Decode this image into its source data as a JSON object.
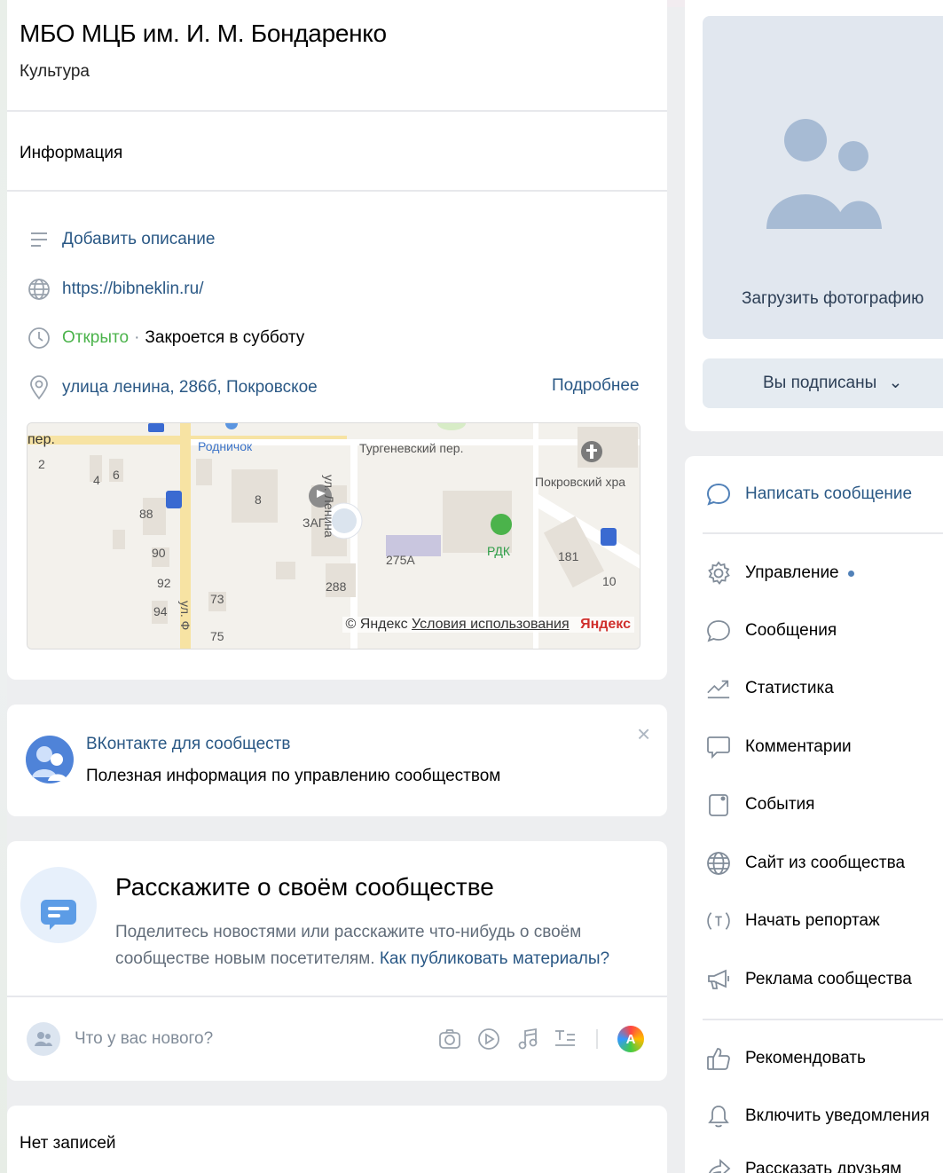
{
  "group": {
    "name": "МБО МЦБ им. И. М. Бондаренко",
    "category": "Культура"
  },
  "info": {
    "heading": "Информация",
    "add_description": "Добавить описание",
    "website": "https://bibneklin.ru/",
    "status_open": "Открыто",
    "status_sep": "·",
    "status_closes": "Закроется в субботу",
    "address": "улица ленина, 286б, Покровское",
    "more_link": "Подробнее"
  },
  "map": {
    "labels": [
      "Родничок",
      "Тургеневский пер.",
      "Покровский хра",
      "ул. Ленина",
      "ЗАГ",
      "РДК",
      "275А",
      "288",
      "181",
      "10",
      "ул. Ф",
      "88",
      "90",
      "92",
      "94",
      "73",
      "75",
      "8",
      "4",
      "6",
      "2",
      "пер."
    ],
    "attribution_prefix": "© Яндекс",
    "terms_link": "Условия использования",
    "brand": "Яндекс"
  },
  "tip": {
    "title": "ВКонтакте для сообществ",
    "subtitle": "Полезная информация по управлению сообществом",
    "close": "×"
  },
  "tell": {
    "title": "Расскажите о своём сообществе",
    "text": "Поделитесь новостями или расскажите что-нибудь о своём сообществе новым посетителям.",
    "link": "Как публиковать материалы?"
  },
  "composer": {
    "placeholder": "Что у вас нового?",
    "avatar_letter": "A"
  },
  "feed": {
    "empty": "Нет записей"
  },
  "side": {
    "upload_photo": "Загрузить фотографию",
    "subscribed": "Вы подписаны",
    "subscribed_caret": "⌄"
  },
  "actions": [
    {
      "label": "Написать сообщение"
    },
    {
      "label": "Управление"
    },
    {
      "label": "Сообщения"
    },
    {
      "label": "Статистика"
    },
    {
      "label": "Комментарии"
    },
    {
      "label": "События"
    },
    {
      "label": "Сайт из сообщества"
    },
    {
      "label": "Начать репортаж"
    },
    {
      "label": "Реклама сообщества"
    },
    {
      "label": "Рекомендовать"
    },
    {
      "label": "Включить уведомления"
    },
    {
      "label": "Рассказать друзьям"
    }
  ],
  "colors": {
    "link": "#2a5885",
    "accent": "#5181b8",
    "open": "#4bb34b",
    "muted": "#818c99"
  }
}
